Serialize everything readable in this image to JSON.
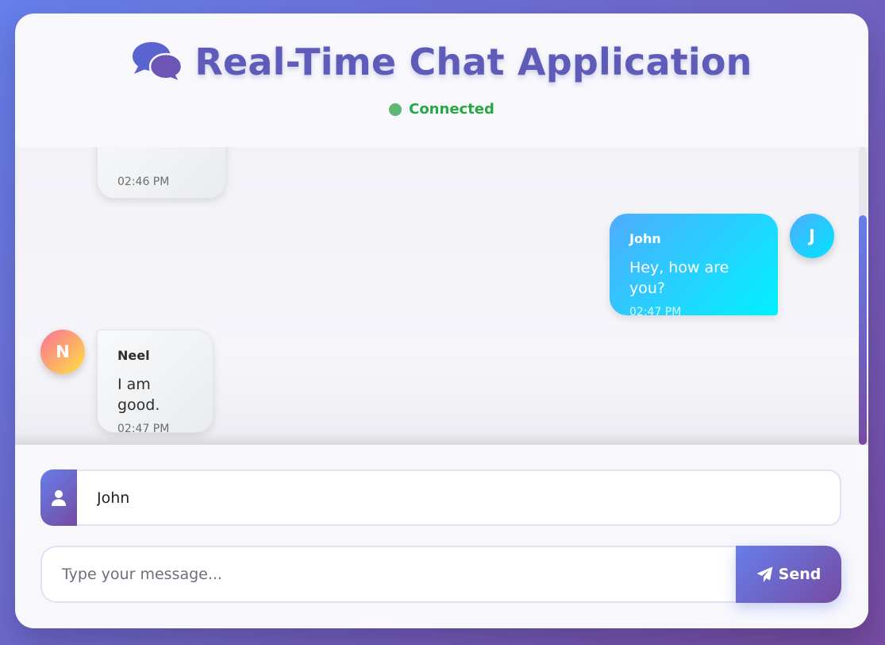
{
  "app": {
    "title": "Real-Time Chat Application",
    "title_icon": "comments-icon",
    "status": {
      "label": "Connected",
      "color": "#28a745"
    }
  },
  "messages": [
    {
      "sender": "",
      "text": "",
      "time": "02:46 PM",
      "side": "other",
      "partially_visible": true
    },
    {
      "sender": "John",
      "text": "Hey, how are you?",
      "time": "02:47 PM",
      "side": "self",
      "avatar_initial": "J"
    },
    {
      "sender": "Neel",
      "text": "I am good.",
      "time": "02:47 PM",
      "side": "other",
      "avatar_initial": "N"
    }
  ],
  "composer": {
    "name_icon": "user-icon",
    "name_value": "John",
    "message_placeholder": "Type your message...",
    "message_value": "",
    "send_label": "Send",
    "send_icon": "paper-plane-icon"
  },
  "colors": {
    "background_gradient": [
      "#667eea",
      "#764ba2"
    ],
    "self_bubble_gradient": [
      "#4facfe",
      "#00f2fe"
    ],
    "other_avatar_gradient": [
      "#fa709a",
      "#fee140"
    ],
    "title_color": "#5e5cb8"
  }
}
